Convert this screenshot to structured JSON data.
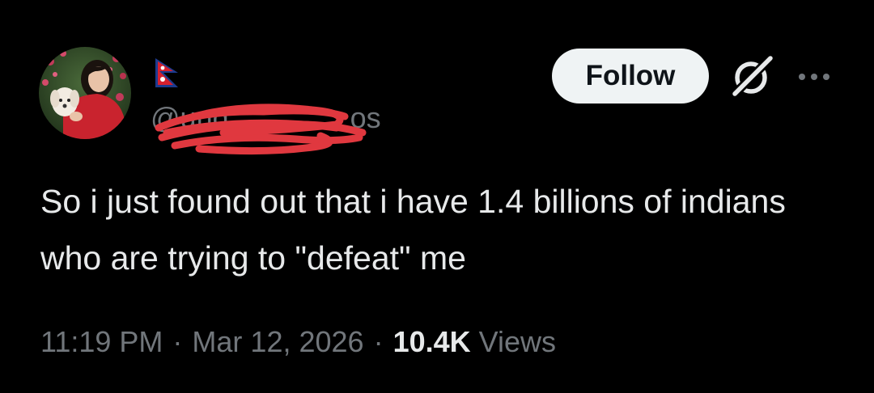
{
  "author": {
    "handle": "@und",
    "handle_suffix": "os",
    "avatar_icon": "profile-photo-woman-with-dog",
    "flag_icon": "nepal-flag-icon",
    "handle_redacted": true,
    "redaction_color": "#e0383f"
  },
  "actions": {
    "follow_label": "Follow",
    "grok_icon": "grok-icon",
    "more_icon": "more-horizontal-icon"
  },
  "tweet": {
    "text": "So i just found out that i have 1.4 billions of indians who are trying to \"defeat\" me"
  },
  "meta": {
    "time": "11:19 PM",
    "separator": "·",
    "date": "Mar 12, 2026",
    "views_count": "10.4K",
    "views_label": "Views"
  },
  "colors": {
    "background": "#000000",
    "text_primary": "#e7e9ea",
    "text_secondary": "#71767b",
    "follow_bg": "#eff3f4",
    "follow_text": "#0f1419"
  }
}
